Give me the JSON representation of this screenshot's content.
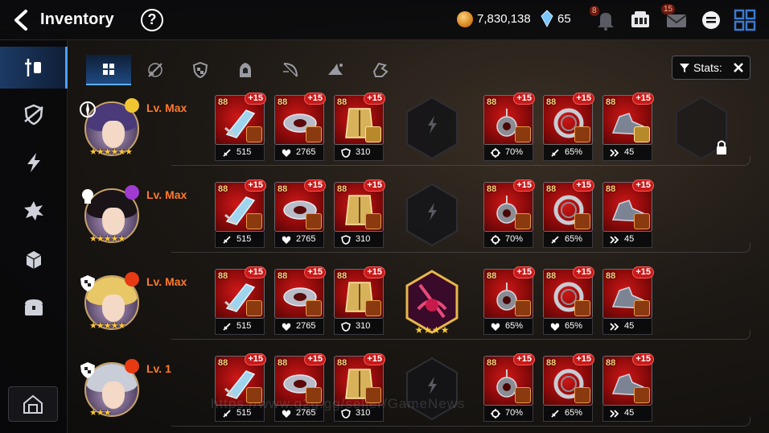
{
  "header": {
    "title": "Inventory",
    "help": "?",
    "gold": "7,830,138",
    "crystals": "65",
    "bell_badge": "8",
    "mail_badge": "15"
  },
  "toolbar": {
    "stats_label": "Stats:"
  },
  "tabs": [
    "all",
    "weapon",
    "helmet",
    "armor",
    "necklace",
    "ring",
    "boots"
  ],
  "sidebar": [
    "equipment",
    "exclusive",
    "artifact",
    "catalyst",
    "material",
    "chest",
    "storage"
  ],
  "rows": [
    {
      "level": "Lv. Max",
      "stars": "★★★★★★",
      "left": [
        {
          "lv": "88",
          "plus": "+15",
          "stat": "515"
        },
        {
          "lv": "88",
          "plus": "+15",
          "stat": "2765"
        },
        {
          "lv": "88",
          "plus": "+15",
          "stat": "310"
        }
      ],
      "right": [
        {
          "lv": "88",
          "plus": "+15",
          "stat": "70%"
        },
        {
          "lv": "88",
          "plus": "+15",
          "stat": "65%"
        },
        {
          "lv": "88",
          "plus": "+15",
          "stat": "45"
        }
      ]
    },
    {
      "level": "Lv. Max",
      "stars": "★★★★★",
      "left": [
        {
          "lv": "88",
          "plus": "+15",
          "stat": "515"
        },
        {
          "lv": "88",
          "plus": "+15",
          "stat": "2765"
        },
        {
          "lv": "88",
          "plus": "+15",
          "stat": "310"
        }
      ],
      "right": [
        {
          "lv": "88",
          "plus": "+15",
          "stat": "70%"
        },
        {
          "lv": "88",
          "plus": "+15",
          "stat": "65%"
        },
        {
          "lv": "88",
          "plus": "+15",
          "stat": "45"
        }
      ]
    },
    {
      "level": "Lv. Max",
      "stars": "★★★★★",
      "left": [
        {
          "lv": "88",
          "plus": "+15",
          "stat": "515"
        },
        {
          "lv": "88",
          "plus": "+15",
          "stat": "2765"
        },
        {
          "lv": "88",
          "plus": "+15",
          "stat": "310"
        }
      ],
      "right": [
        {
          "lv": "88",
          "plus": "+15",
          "stat": "65%"
        },
        {
          "lv": "88",
          "plus": "+15",
          "stat": "65%"
        },
        {
          "lv": "88",
          "plus": "+15",
          "stat": "45"
        }
      ]
    },
    {
      "level": "Lv. 1",
      "stars": "★★★",
      "left": [
        {
          "lv": "88",
          "plus": "+15",
          "stat": "515"
        },
        {
          "lv": "88",
          "plus": "+15",
          "stat": "2765"
        },
        {
          "lv": "88",
          "plus": "+15",
          "stat": "310"
        }
      ],
      "right": [
        {
          "lv": "88",
          "plus": "+15",
          "stat": "70%"
        },
        {
          "lv": "88",
          "plus": "+15",
          "stat": "65%"
        },
        {
          "lv": "88",
          "plus": "+15",
          "stat": "45"
        }
      ]
    }
  ],
  "watermark": "https://www.g2g.gg/seller/GameNews"
}
